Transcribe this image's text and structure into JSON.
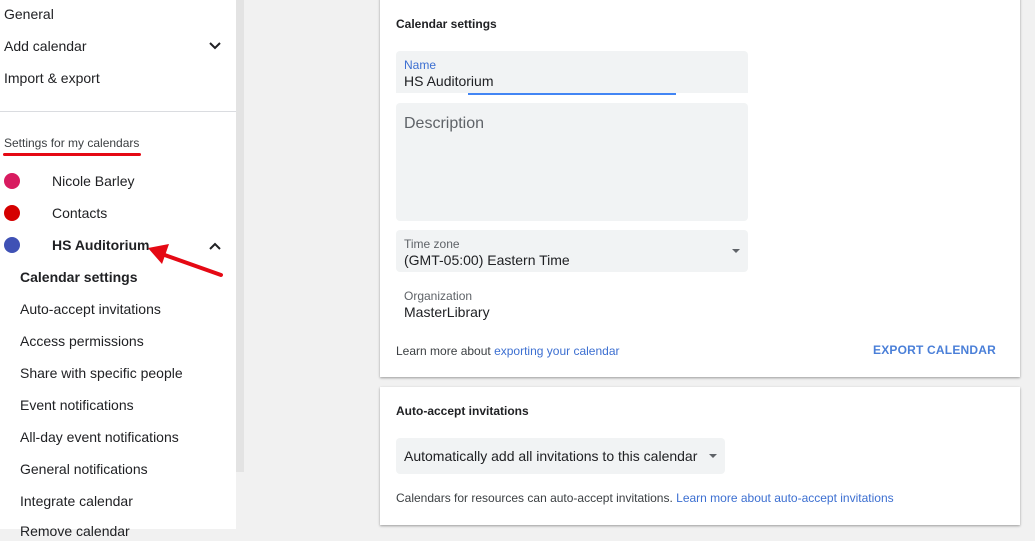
{
  "sidebar": {
    "general": "General",
    "add_calendar": "Add calendar",
    "import_export": "Import & export",
    "section_heading": "Settings for my calendars",
    "calendars": [
      {
        "label": "Nicole Barley",
        "color": "#d81b60"
      },
      {
        "label": "Contacts",
        "color": "#d50000"
      },
      {
        "label": "HS Auditorium",
        "color": "#3f51b5"
      }
    ],
    "sub_items": [
      "Calendar settings",
      "Auto-accept invitations",
      "Access permissions",
      "Share with specific people",
      "Event notifications",
      "All-day event notifications",
      "General notifications",
      "Integrate calendar",
      "Remove calendar"
    ]
  },
  "calendar_settings": {
    "title": "Calendar settings",
    "name_label": "Name",
    "name_value": "HS Auditorium",
    "description_placeholder": "Description",
    "timezone_label": "Time zone",
    "timezone_value": "(GMT-05:00) Eastern Time",
    "organization_label": "Organization",
    "organization_value": "MasterLibrary",
    "learn_more_prefix": "Learn more about",
    "learn_more_link": "exporting your calendar",
    "export_button": "EXPORT CALENDAR"
  },
  "auto_accept": {
    "title": "Auto-accept invitations",
    "select_value": "Automatically add all invitations to this calendar",
    "note": "Calendars for resources can auto-accept invitations.",
    "note_link": "Learn more about auto-accept invitations"
  },
  "colors": {
    "accent_blue": "#4285f4",
    "link_blue": "#3c6fd1",
    "annotation_red": "#e50914"
  }
}
